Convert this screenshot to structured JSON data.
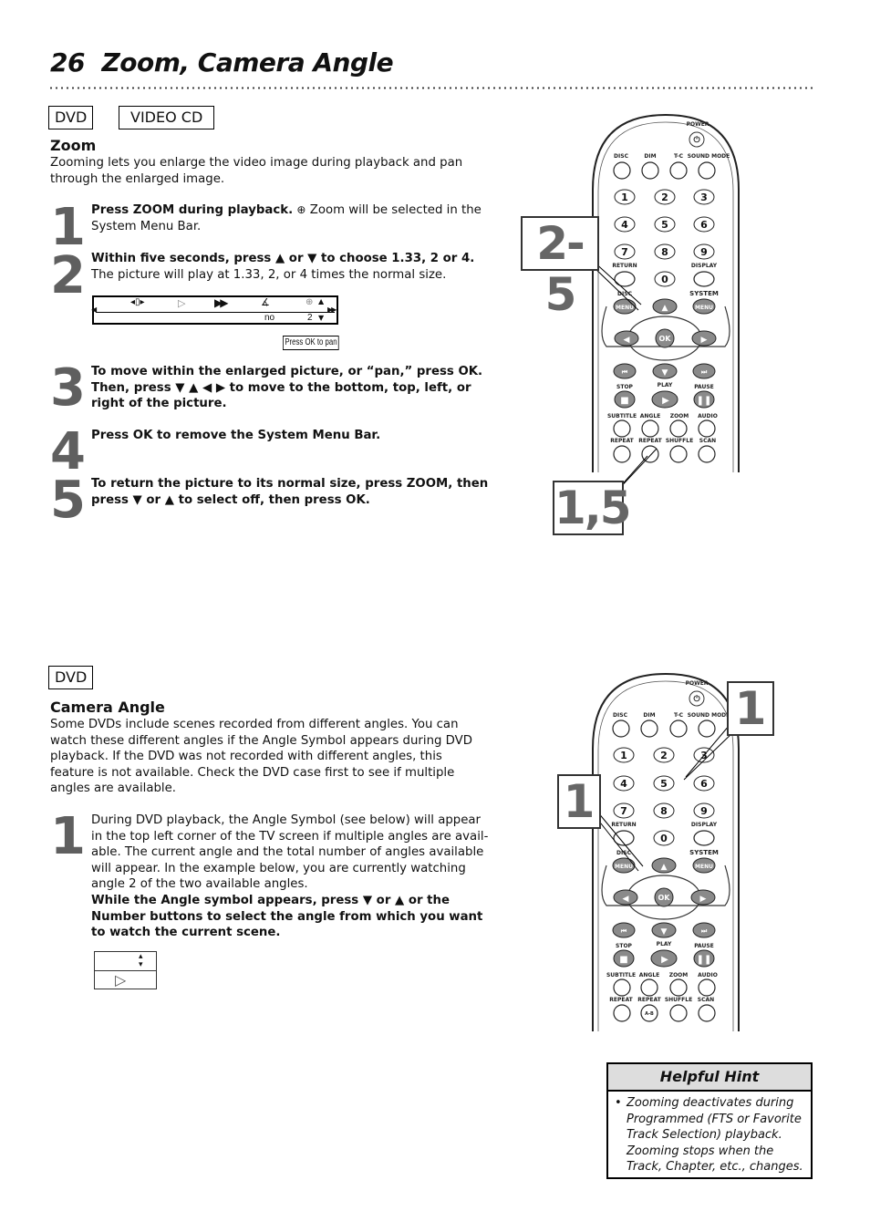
{
  "page": {
    "number": "26",
    "title": "Zoom, Camera Angle"
  },
  "zoom_section": {
    "badges": [
      "DVD",
      "VIDEO CD"
    ],
    "heading": "Zoom",
    "intro": "Zooming lets you enlarge the video image during playback and pan through the enlarged image.",
    "steps": [
      {
        "num": "1",
        "bold": "Press ZOOM during playback.",
        "text": " Zoom will be selected in the System Menu Bar."
      },
      {
        "num": "2",
        "bold": "Within five seconds, press ▲ or ▼ to choose 1.33, 2 or 4.",
        "text": " The picture will play at 1.33, 2, or 4 times the normal size."
      },
      {
        "num": "3",
        "bold": "To move within the enlarged picture, or “pan,” press OK. Then, press ▼ ▲ ◀ ▶ to move to the bottom, top, left, or right of the picture.",
        "text": ""
      },
      {
        "num": "4",
        "bold": "Press OK to remove the System Menu Bar.",
        "text": ""
      },
      {
        "num": "5",
        "bold": "To return the picture to its normal size, press ZOOM, then press ▼ or ▲ to select off, then press OK.",
        "text": ""
      }
    ],
    "menu_bar": {
      "angle_value": "no",
      "zoom_value": "2"
    },
    "pan_hint": "Press OK to pan"
  },
  "angle_section": {
    "badge": "DVD",
    "heading": "Camera Angle",
    "intro": "Some DVDs include scenes recorded from different angles. You can watch these different angles if the Angle Symbol appears during DVD playback. If the DVD was not recorded with different angles, this feature is not available. Check the DVD case first to see if multiple angles are available.",
    "step": {
      "num": "1",
      "text": "During DVD playback, the Angle Symbol (see below) will appear in the top left corner of the TV screen if multiple angles are avail-able. The current angle and the total number of angles available will appear. In the example below, you are currently watching angle 2 of the two available angles.",
      "bold": "While the Angle symbol appears, press ▼ or ▲ or the Number buttons to select the angle from which you want to watch the current scene."
    }
  },
  "remote": {
    "power": "POWER",
    "top_labels": [
      "DISC",
      "DIM",
      "T-C",
      "SOUND MODE"
    ],
    "numbers": [
      "1",
      "2",
      "3",
      "4",
      "5",
      "6",
      "7",
      "8",
      "9",
      "0"
    ],
    "return": "RETURN",
    "display": "DISPLAY",
    "disc_menu": "DISC",
    "system": "SYSTEM",
    "menu": "MENU",
    "ok": "OK",
    "stop": "STOP",
    "play": "PLAY",
    "pause": "PAUSE",
    "row_a": [
      "SUBTITLE",
      "ANGLE",
      "ZOOM",
      "AUDIO"
    ],
    "row_b": [
      "REPEAT",
      "REPEAT",
      "SHUFFLE",
      "SCAN"
    ],
    "ab": "A-B"
  },
  "callouts": {
    "zoom_top": "2-5",
    "zoom_bottom": "1,5",
    "angle_right": "1",
    "angle_left": "1"
  },
  "hint": {
    "title": "Helpful Hint",
    "bullet": "•",
    "text": "Zooming deactivates during Programmed (FTS or Favorite Track Selection) playback. Zooming stops when the Track, Chapter, etc., changes."
  }
}
